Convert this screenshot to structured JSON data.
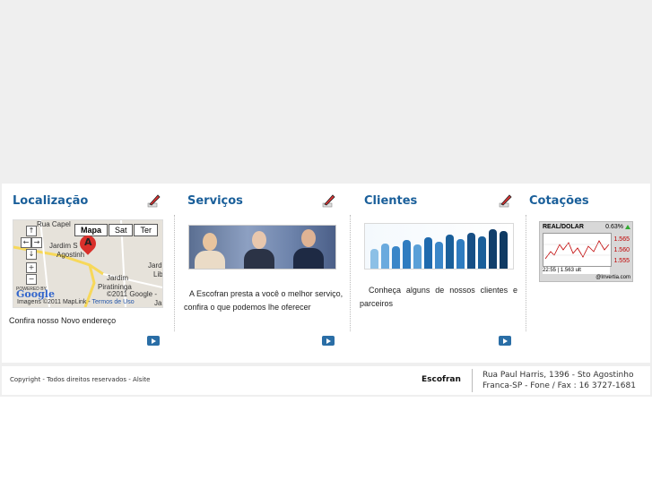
{
  "sections": {
    "localizacao": {
      "title": "Localização",
      "desc": "Confira nosso Novo endereço",
      "map": {
        "tabs": [
          "Mapa",
          "Sat",
          "Ter"
        ],
        "labels": [
          "Rua Capel",
          "Jardim S",
          "Agostinh",
          "Jardim",
          "Piratininga",
          "Jardi",
          "Lib",
          "Jar"
        ],
        "marker": "A",
        "copyright": "©2011 Google -",
        "credit": "Imagens ©2011 MapLink -",
        "terms": "Termos de Uso",
        "powered_by": "POWERED BY",
        "logo": "Google"
      }
    },
    "servicos": {
      "title": "Serviços",
      "desc": "A Escofran presta a você o melhor serviço, confira o que podemos lhe oferecer"
    },
    "clientes": {
      "title": "Clientes",
      "desc": "Conheça alguns de nossos clientes e parceiros"
    },
    "cotacoes": {
      "title": "Cotações",
      "quote": {
        "pair": "REAL/DOLAR",
        "change": "0.63%",
        "ticks": [
          "1.565",
          "1.560",
          "1.555"
        ],
        "time": "22:55",
        "separator": "|",
        "value": "1.563 ult",
        "source": "@Invertia.com"
      }
    }
  },
  "footer": {
    "copyright": "Copyright - Todos direitos reservados - Alsite",
    "brand": "Escofran",
    "address_line1": "Rua Paul Harris, 1396 - Sto Agostinho",
    "address_line2": "Franca-SP - Fone / Fax : 16 3727-1681"
  },
  "colors": {
    "accent": "#1a5f9a",
    "button": "#2a6ea6",
    "page_bg": "#efefef"
  }
}
